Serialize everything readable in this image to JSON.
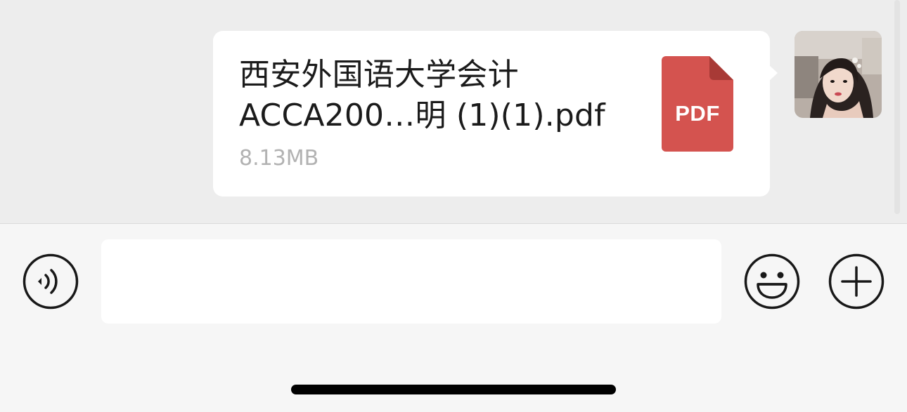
{
  "message": {
    "file_name_line1": "西安外国语大学会计",
    "file_name_line2": "ACCA200…明 (1)(1).pdf",
    "file_size": "8.13MB",
    "file_type_label": "PDF"
  },
  "input_bar": {
    "text_value": "",
    "placeholder": ""
  },
  "icons": {
    "voice": "voice-mode-icon",
    "emoji": "emoji-icon",
    "more": "plus-icon",
    "file": "pdf-file-icon"
  },
  "colors": {
    "chat_background": "#ededed",
    "bubble": "#ffffff",
    "pdf_red": "#d4534f",
    "input_bar": "#f6f6f6",
    "secondary_text": "#b2b2b2"
  }
}
